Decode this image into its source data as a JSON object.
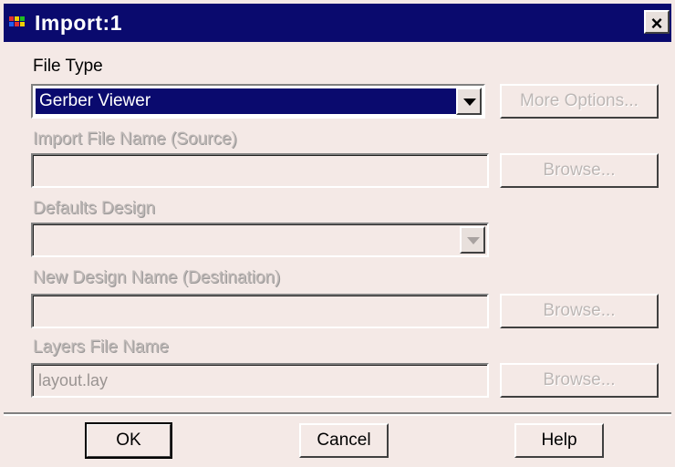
{
  "window": {
    "title": "Import:1",
    "close_label": "×"
  },
  "file_type": {
    "label": "File Type",
    "value": "Gerber Viewer",
    "more_options": "More Options..."
  },
  "import_file": {
    "label": "Import File Name (Source)",
    "value": "",
    "browse": "Browse..."
  },
  "defaults_design": {
    "label": "Defaults Design",
    "value": ""
  },
  "new_design": {
    "label": "New Design Name (Destination)",
    "value": "",
    "browse": "Browse..."
  },
  "layers_file": {
    "label": "Layers File Name",
    "value": "layout.lay",
    "browse": "Browse..."
  },
  "buttons": {
    "ok": "OK",
    "cancel": "Cancel",
    "help": "Help"
  },
  "colors": {
    "titlebar": "#0a0a6e",
    "background": "#f4e9e6",
    "selection": "#0a0a6e"
  }
}
